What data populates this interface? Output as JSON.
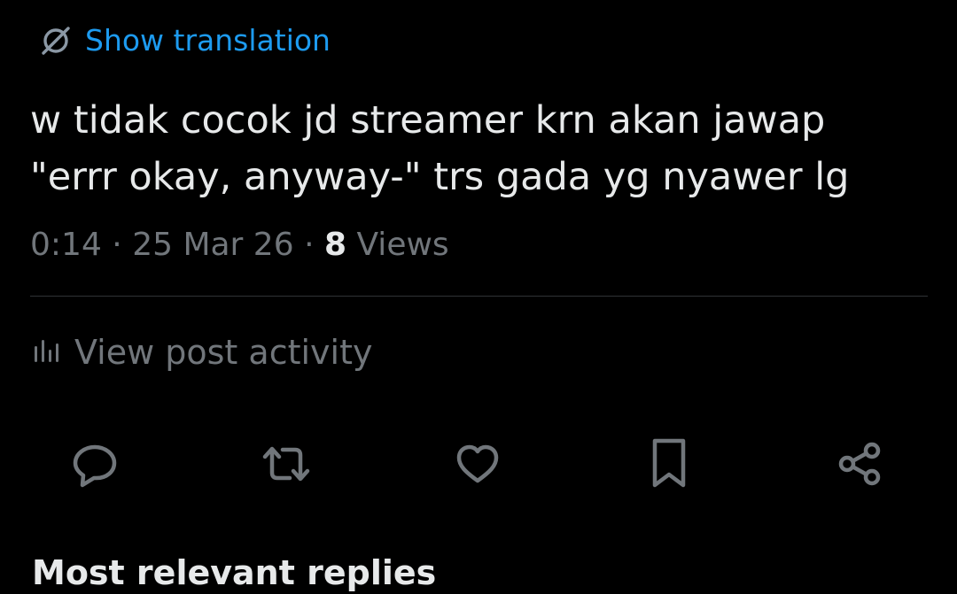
{
  "translation": {
    "label": "Show translation",
    "icon": "globe-slash-icon",
    "color": "#1d9bf0"
  },
  "post": {
    "text": "w tidak cocok jd streamer krn akan jawap\n\"errr okay, anyway-\" trs gada yg nyawer lg",
    "time": "0:14",
    "separator1": " · ",
    "date": "25 Mar 26",
    "separator2": " · ",
    "views_count": "8",
    "views_label": " Views"
  },
  "activity": {
    "label": "View post activity",
    "icon": "analytics-bars-icon"
  },
  "actions": [
    {
      "name": "reply",
      "icon": "reply-bubble-icon"
    },
    {
      "name": "repost",
      "icon": "repost-arrows-icon"
    },
    {
      "name": "like",
      "icon": "heart-icon"
    },
    {
      "name": "bookmark",
      "icon": "bookmark-icon"
    },
    {
      "name": "share",
      "icon": "share-nodes-icon"
    }
  ],
  "colors": {
    "background": "#000000",
    "primary_text": "#e7e9ea",
    "secondary_text": "#71767b",
    "divider": "#2f3336",
    "link": "#1d9bf0"
  },
  "bottom_peek_text": "Most relevant replies"
}
